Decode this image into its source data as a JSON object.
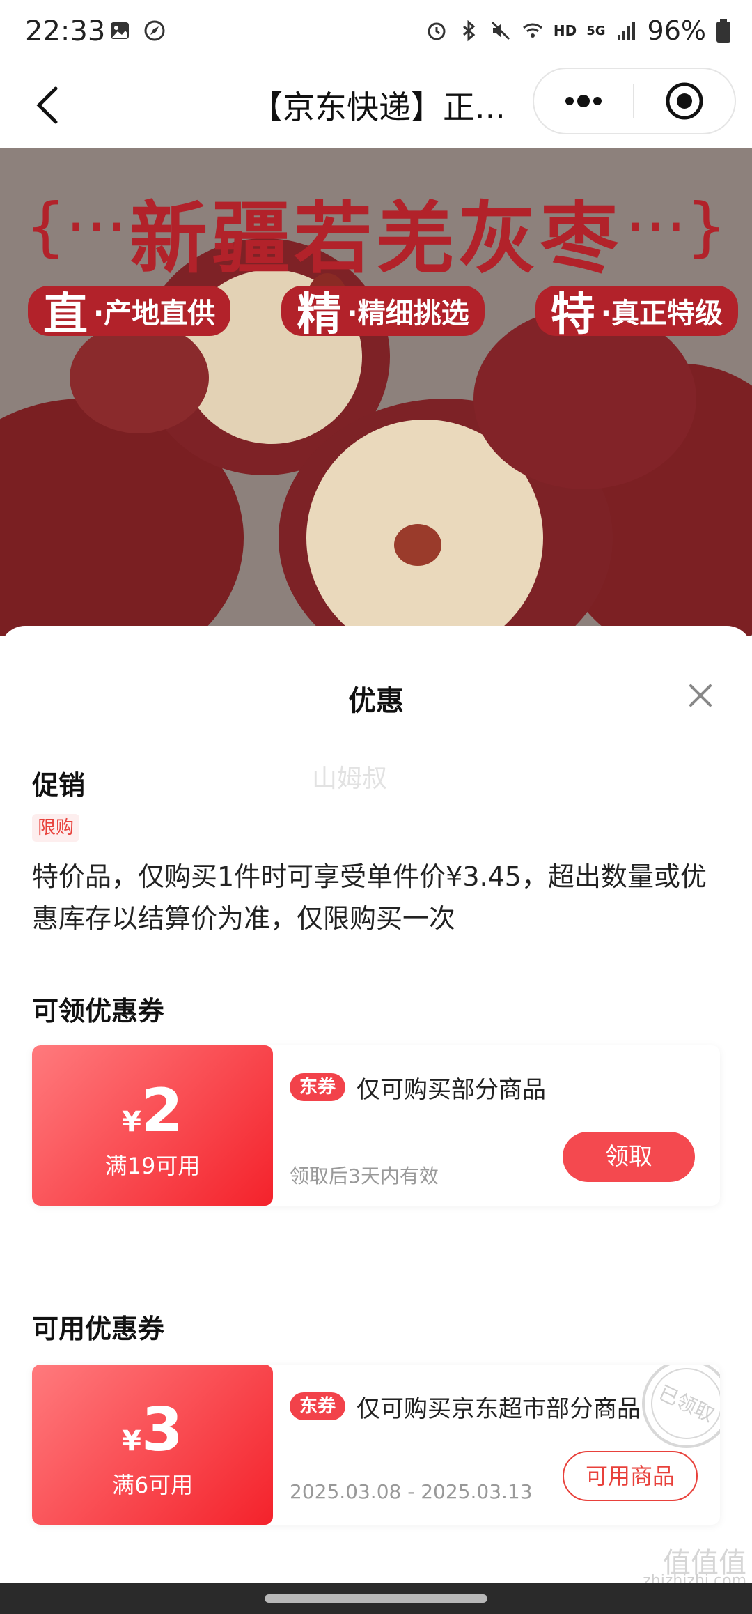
{
  "status_bar": {
    "time": "22:33",
    "battery": "96%",
    "net_label": "HD",
    "signal_label": "5G",
    "left_icons": [
      "image-icon",
      "compass-icon"
    ],
    "right_icons": [
      "alarm-icon",
      "bluetooth-icon",
      "mute-icon",
      "wifi-icon",
      "signal-icon",
      "battery-icon"
    ]
  },
  "nav": {
    "title": "【京东快递】正...",
    "back_icon": "back-icon",
    "more_icon": "more-icon",
    "close_icon": "target-icon"
  },
  "banner": {
    "title": "新疆若羌灰枣",
    "brace_left": "{···",
    "brace_right": "···}",
    "tags": [
      {
        "big": "直",
        "small": "·产地直供"
      },
      {
        "big": "精",
        "small": "·精细挑选"
      },
      {
        "big": "特",
        "small": "·真正特级"
      }
    ]
  },
  "sheet": {
    "title": "优惠",
    "watermark": "山姆叔",
    "promotion": {
      "section_title": "促销",
      "tag": "限购",
      "description": "特价品，仅购买1件时可享受单件价¥3.45，超出数量或优惠库存以结算价为准，仅限购买一次"
    },
    "claimable": {
      "section_title": "可领优惠券",
      "coupon": {
        "yen": "¥",
        "amount": "2",
        "condition": "满19可用",
        "badge": "东券",
        "description": "仅可购买部分商品",
        "validity": "领取后3天内有效",
        "button": "领取"
      }
    },
    "usable": {
      "section_title": "可用优惠券",
      "coupon": {
        "yen": "¥",
        "amount": "3",
        "condition": "满6可用",
        "badge": "东券",
        "description": "仅可购买京东超市部分商品",
        "validity": "2025.03.08 - 2025.03.13",
        "button": "可用商品",
        "stamp": "已领取"
      }
    }
  },
  "corner_watermark": {
    "line1": "值值值",
    "line2": "zhizhizhi.com"
  },
  "colors": {
    "accent": "#f4494f",
    "coupon_gradient_start": "#ff7a7d",
    "coupon_gradient_end": "#f4222b",
    "banner_text": "#b2222a"
  }
}
